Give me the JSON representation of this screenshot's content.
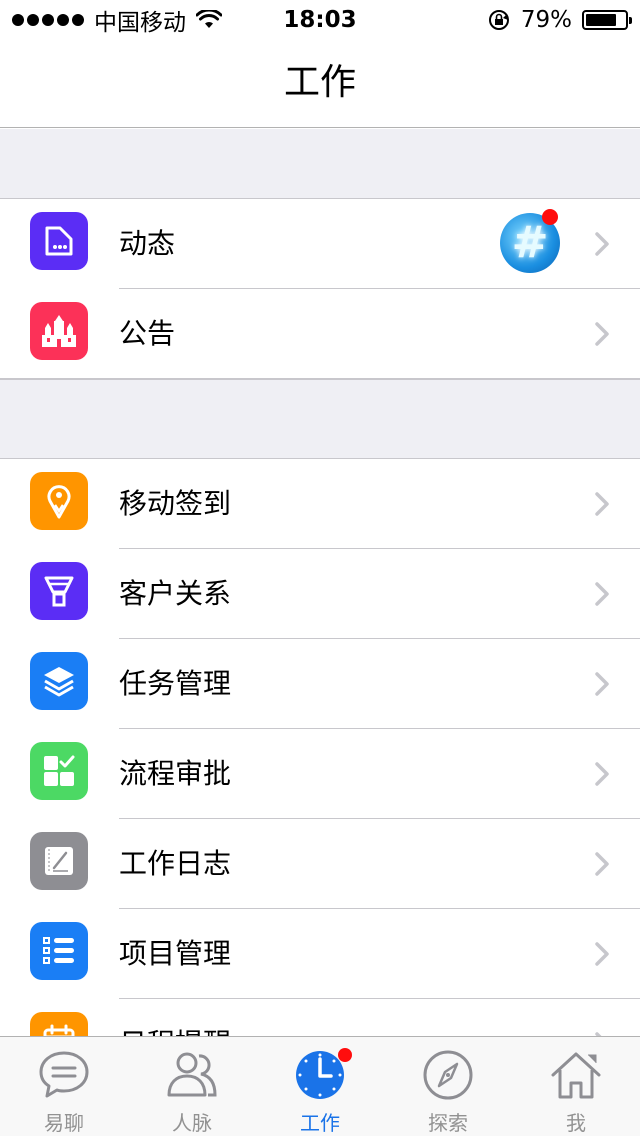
{
  "status_bar": {
    "carrier": "中国移动",
    "time": "18:03",
    "battery_percent": "79%",
    "battery_level": 0.79,
    "signal_bars": 5
  },
  "nav": {
    "title": "工作"
  },
  "section1": [
    {
      "label": "动态",
      "icon": "document-icon",
      "color": "#5b2df5"
    },
    {
      "label": "公告",
      "icon": "castle-icon",
      "color": "#fc3158"
    }
  ],
  "section2": [
    {
      "label": "移动签到",
      "icon": "location-pin-icon",
      "color": "#ff9500"
    },
    {
      "label": "客户关系",
      "icon": "funnel-icon",
      "color": "#5b2df5"
    },
    {
      "label": "任务管理",
      "icon": "layers-icon",
      "color": "#1a7ef5"
    },
    {
      "label": "流程审批",
      "icon": "approval-grid-icon",
      "color": "#4cd964"
    },
    {
      "label": "工作日志",
      "icon": "notebook-edit-icon",
      "color": "#8e8e93"
    },
    {
      "label": "项目管理",
      "icon": "list-icon",
      "color": "#1a7ef5"
    },
    {
      "label": "日程提醒",
      "icon": "calendar-icon",
      "color": "#ff9500"
    }
  ],
  "tabs": [
    {
      "label": "易聊",
      "icon": "chat-bubble-icon",
      "active": false
    },
    {
      "label": "人脉",
      "icon": "contacts-icon",
      "active": false
    },
    {
      "label": "工作",
      "icon": "clock-icon",
      "active": true
    },
    {
      "label": "探索",
      "icon": "compass-icon",
      "active": false
    },
    {
      "label": "我",
      "icon": "home-icon",
      "active": false
    }
  ],
  "colors": {
    "accent": "#1a73e8",
    "badge_red": "#ff0d0d",
    "separator": "#c8c7cc",
    "group_bg": "#efeff4"
  }
}
